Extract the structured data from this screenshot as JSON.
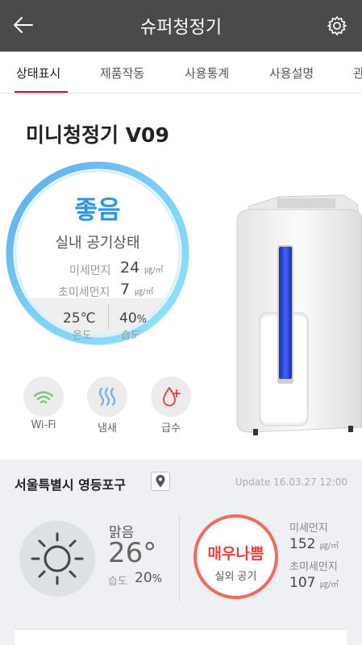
{
  "header": {
    "title": "슈퍼청정기",
    "back_icon": "arrow-left-icon",
    "settings_icon": "gear-icon"
  },
  "tabs": [
    {
      "label": "상태표시",
      "active": true
    },
    {
      "label": "제품작동",
      "active": false
    },
    {
      "label": "사용통계",
      "active": false
    },
    {
      "label": "사용설명",
      "active": false
    },
    {
      "label": "관",
      "active": false
    }
  ],
  "device": {
    "model": "미니청정기 V09",
    "air_status": "좋음",
    "air_status_label": "실내 공기상태",
    "fine_dust_label": "미세먼지",
    "fine_dust_value": "24",
    "ultrafine_dust_label": "초미세먼지",
    "ultrafine_dust_value": "7",
    "dust_unit": "㎍/㎥",
    "temperature_value": "25",
    "temperature_unit": "℃",
    "temperature_label": "온도",
    "humidity_value": "40",
    "humidity_unit": "%",
    "humidity_label": "습도",
    "features": [
      {
        "label": "Wi-Fi",
        "icon": "wifi-icon"
      },
      {
        "label": "냄새",
        "icon": "odor-icon"
      },
      {
        "label": "급수",
        "icon": "water-drop-plus-icon"
      }
    ]
  },
  "weather": {
    "location": "서울특별시 영등포구",
    "location_icon": "map-pin-icon",
    "update": "Update 16.03.27 12:00",
    "condition": "맑음",
    "condition_icon": "sun-icon",
    "temperature": "26°",
    "humidity_label": "습도",
    "humidity_value": "20",
    "humidity_unit": "%",
    "outdoor_status": "매우나쁨",
    "outdoor_label": "실외 공기",
    "fine_dust_label": "미세먼지",
    "fine_dust_value": "152",
    "ultrafine_dust_label": "초미세먼지",
    "ultrafine_dust_value": "107",
    "dust_unit": "㎍/㎥"
  },
  "colors": {
    "header_bg": "#4a4a4a",
    "accent": "#c8102e",
    "good": "#2b96e8",
    "bad": "#e8423a"
  }
}
